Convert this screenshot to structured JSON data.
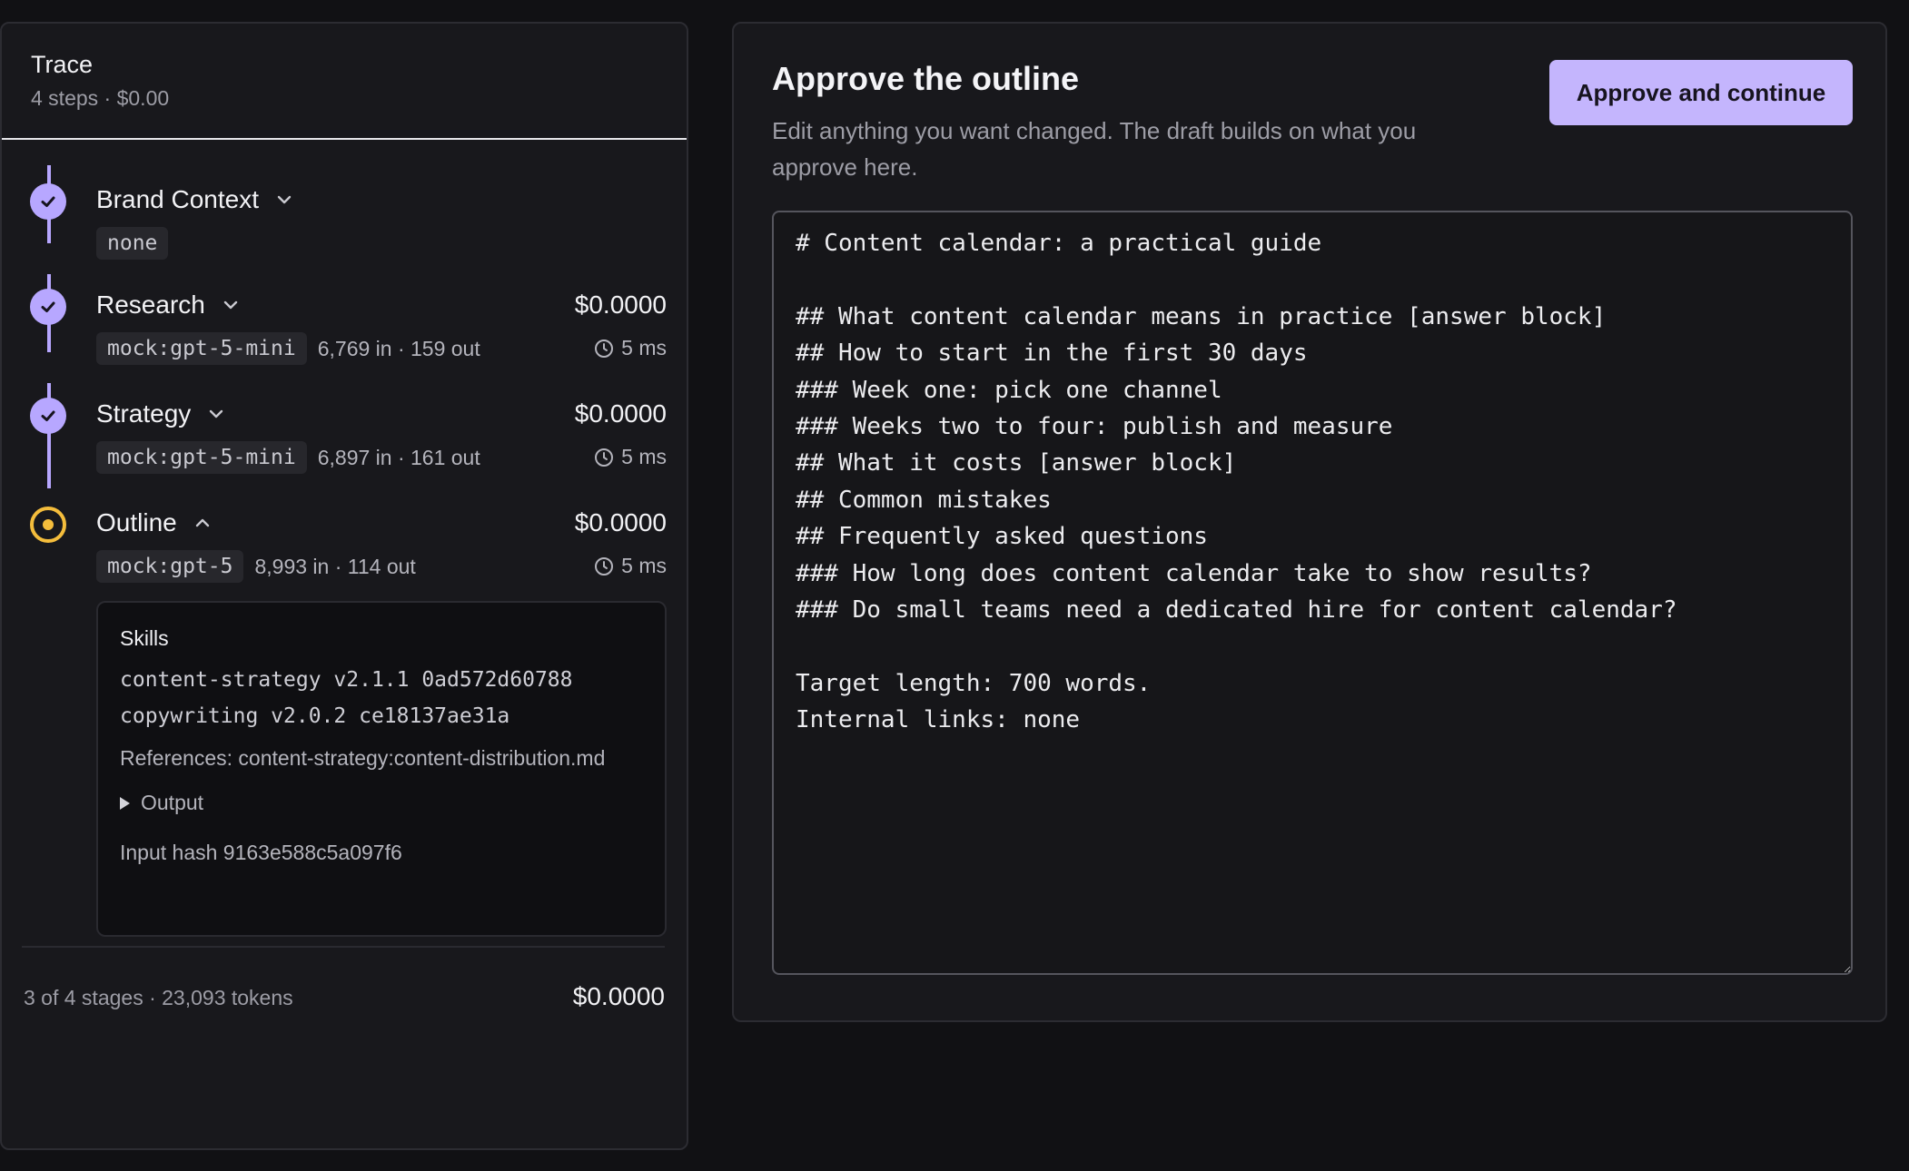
{
  "trace": {
    "title": "Trace",
    "summary": "4 steps · $0.00",
    "steps": [
      {
        "name": "Brand Context",
        "status": "done",
        "expanded": false,
        "chip": "none"
      },
      {
        "name": "Research",
        "status": "done",
        "expanded": false,
        "cost": "$0.0000",
        "model": "mock:gpt-5-mini",
        "tokens": "6,769 in · 159 out",
        "duration": "5 ms"
      },
      {
        "name": "Strategy",
        "status": "done",
        "expanded": false,
        "cost": "$0.0000",
        "model": "mock:gpt-5-mini",
        "tokens": "6,897 in · 161 out",
        "duration": "5 ms"
      },
      {
        "name": "Outline",
        "status": "active",
        "expanded": true,
        "cost": "$0.0000",
        "model": "mock:gpt-5",
        "tokens": "8,993 in · 114 out",
        "duration": "5 ms"
      }
    ],
    "details": {
      "skills_title": "Skills",
      "skills": [
        "content-strategy v2.1.1 0ad572d60788",
        "copywriting v2.0.2 ce18137ae31a"
      ],
      "references": "References: content-strategy:content-distribution.md",
      "output_label": "Output",
      "input_hash": "Input hash 9163e588c5a097f6"
    },
    "footer": {
      "summary": "3 of 4 stages · 23,093 tokens",
      "cost": "$0.0000"
    }
  },
  "approve": {
    "title": "Approve the outline",
    "description": "Edit anything you want changed. The draft builds on what you approve here.",
    "button_label": "Approve and continue",
    "outline_text": "# Content calendar: a practical guide\n\n## What content calendar means in practice [answer block]\n## How to start in the first 30 days\n### Week one: pick one channel\n### Weeks two to four: publish and measure\n## What it costs [answer block]\n## Common mistakes\n## Frequently asked questions\n### How long does content calendar take to show results?\n### Do small teams need a dedicated hire for content calendar?\n\nTarget length: 700 words.\nInternal links: none"
  },
  "colors": {
    "accent": "#c4b5fd",
    "step_done": "#b7a7ff",
    "step_active": "#f4bd3c"
  }
}
